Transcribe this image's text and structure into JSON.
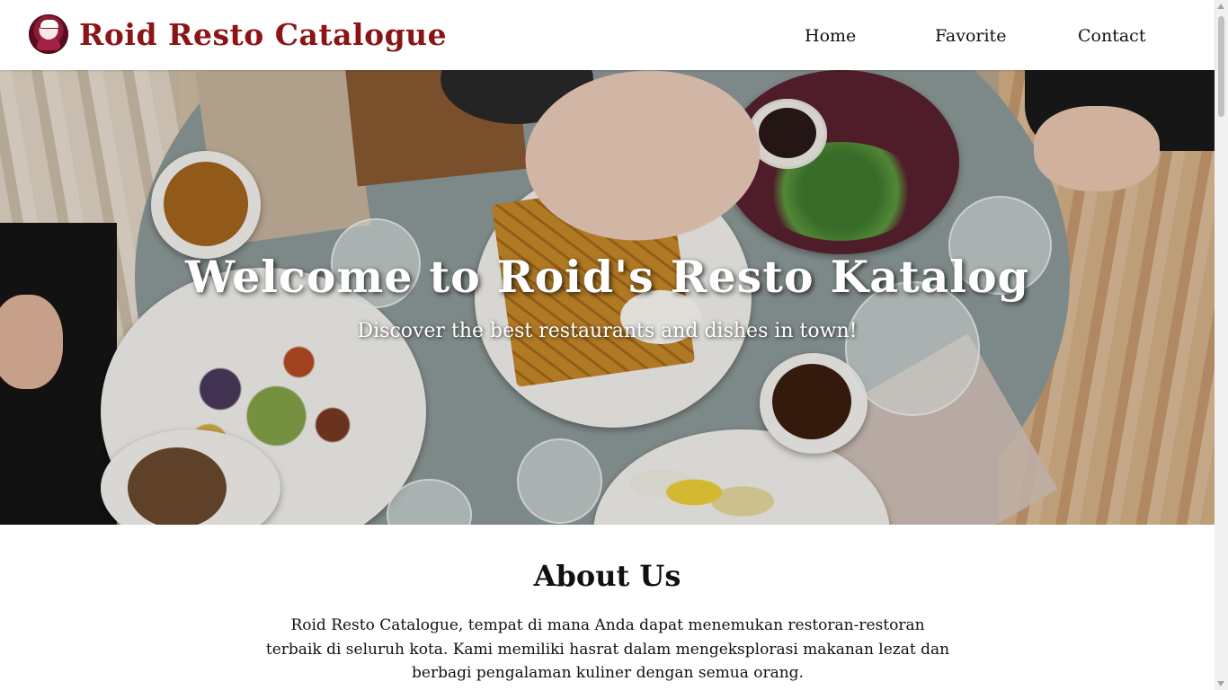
{
  "header": {
    "brand": "Roid Resto Catalogue",
    "logo_icon": "chef-logo-icon",
    "brand_color": "#8b1416",
    "nav": [
      {
        "label": "Home"
      },
      {
        "label": "Favorite"
      },
      {
        "label": "Contact"
      }
    ]
  },
  "hero": {
    "title": "Welcome to Roid's Resto Katalog",
    "subtitle": "Discover the best restaurants and dishes in town!"
  },
  "about": {
    "title": "About Us",
    "text": "Roid Resto Catalogue, tempat di mana Anda dapat menemukan restoran-restoran terbaik di seluruh kota. Kami memiliki hasrat dalam mengeksplorasi makanan lezat dan berbagi pengalaman kuliner dengan semua orang."
  }
}
